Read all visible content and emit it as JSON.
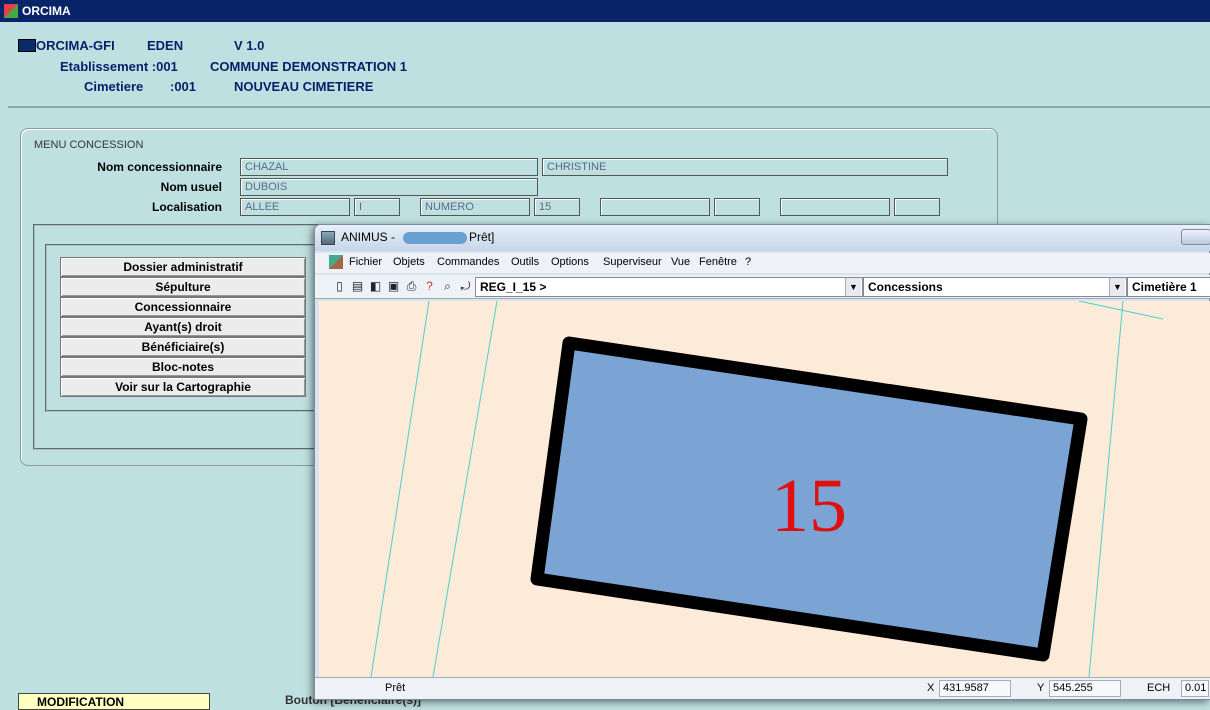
{
  "orcima": {
    "window_title": "ORCIMA",
    "app_name": "ORCIMA-GFI",
    "module": "EDEN",
    "version": "V 1.0",
    "etab_label": "Etablissement :001",
    "etab_value": "COMMUNE DEMONSTRATION 1",
    "cimetiere_label": "Cimetiere",
    "cimetiere_code": ":001",
    "cimetiere_value": "NOUVEAU CIMETIERE"
  },
  "menu": {
    "legend": "MENU CONCESSION",
    "labels": {
      "nom_concessionnaire": "Nom concessionnaire",
      "nom_usuel": "Nom usuel",
      "localisation": "Localisation"
    },
    "fields": {
      "nom": "CHAZAL",
      "prenom": "CHRISTINE",
      "nom_usuel": "DUBOIS",
      "loc1": "ALLEE",
      "loc2": "I",
      "loc3": "NUMERO",
      "loc4": "15",
      "loc5": "",
      "loc6": "",
      "loc7": "",
      "loc8": ""
    },
    "buttons": [
      "Dossier administratif",
      "Sépulture",
      "Concessionnaire",
      "Ayant(s) droit",
      "Bénéficiaire(s)",
      "Bloc-notes",
      "Voir sur la Cartographie"
    ]
  },
  "status": {
    "mode": "MODIFICATION",
    "hint": "Bouton [Bénéficiaire(s)]"
  },
  "animus": {
    "title": "ANIMUS -",
    "title_state": "Prêt]",
    "menu": [
      "Fichier",
      "Objets",
      "Commandes",
      "Outils",
      "Options",
      "Superviseur",
      "Vue",
      "Fenêtre",
      "?"
    ],
    "toolbar_icons": [
      "new-icon",
      "open-icon",
      "layers-icon",
      "save-icon",
      "print-icon",
      "help-icon",
      "zoom-icon",
      "zoom-extent-icon"
    ],
    "combo_ref": "REG_I_15 >",
    "combo_layer": "Concessions",
    "combo_site": "Cimetière 1",
    "plot_label": "15",
    "plot_fill": "#7ba3d4",
    "plot_label_color": "#e01010",
    "status_text": "Prêt",
    "x_label": "X",
    "x_value": "431.9587",
    "y_label": "Y",
    "y_value": "545.255",
    "ech_label": "ECH",
    "ech_value": "0.01"
  }
}
